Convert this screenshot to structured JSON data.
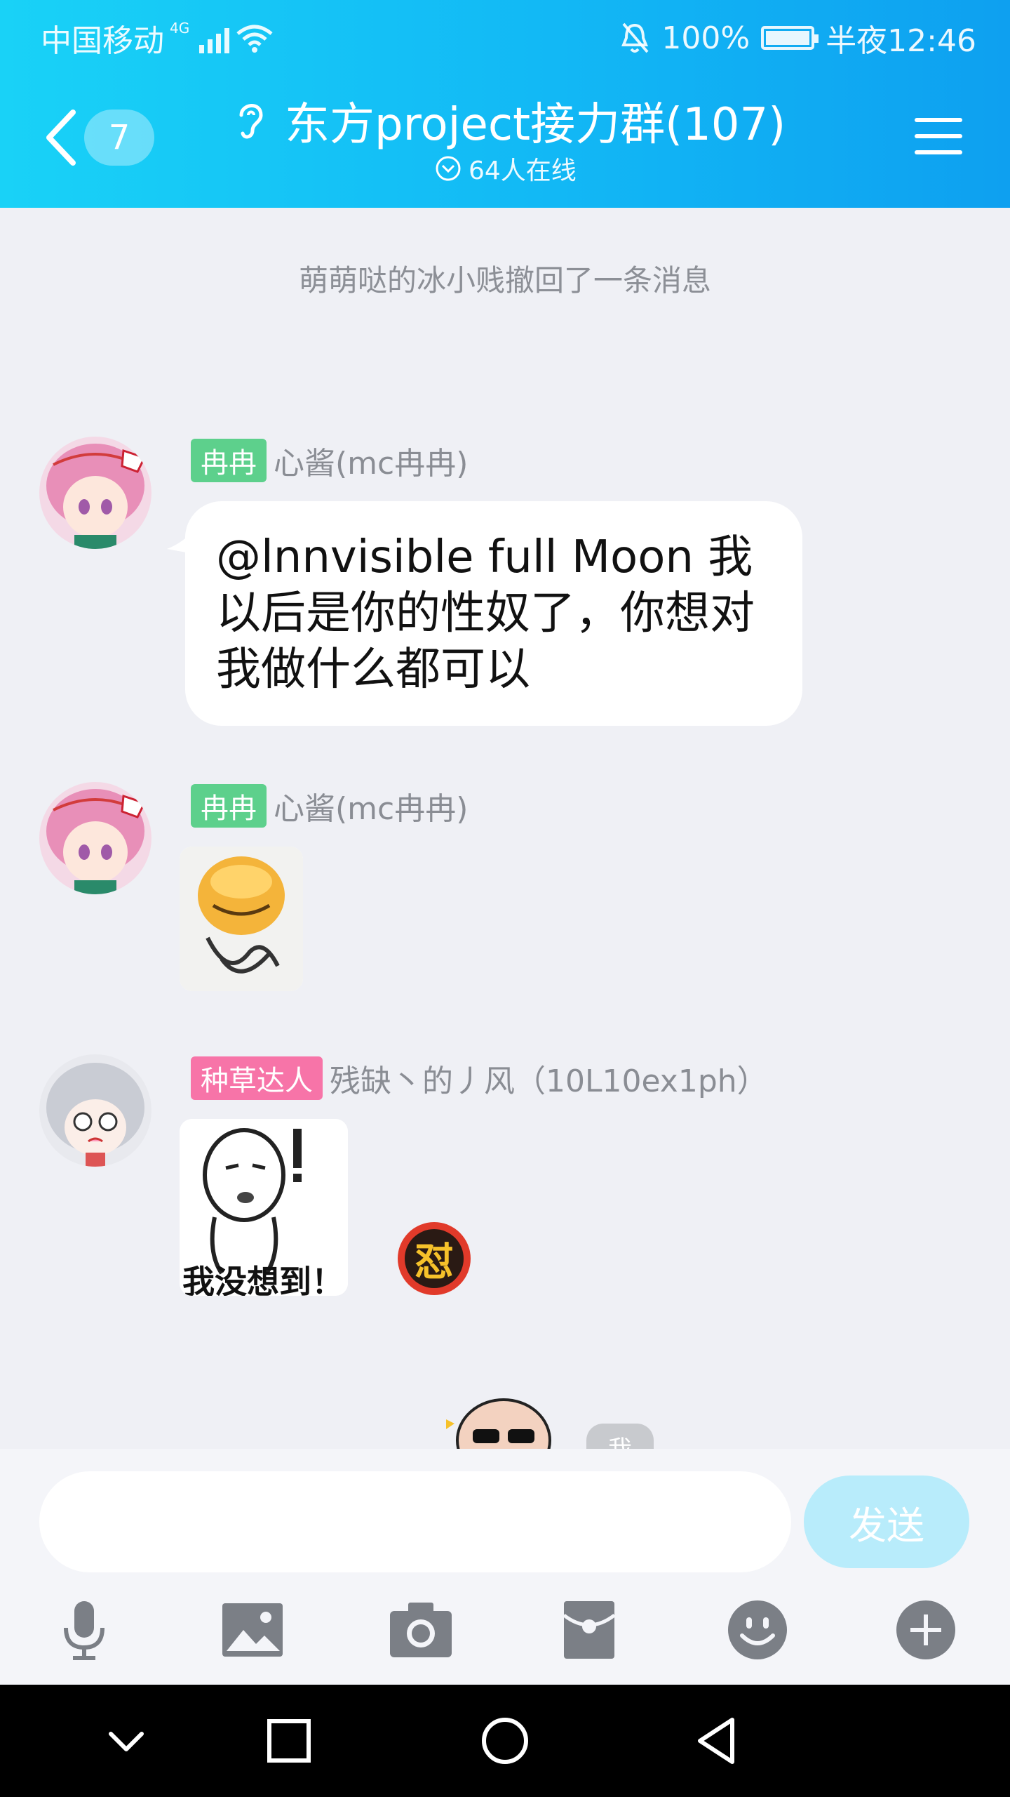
{
  "status_bar": {
    "carrier": "中国移动",
    "network": "4G",
    "battery": "100%",
    "time": "半夜12:46"
  },
  "header": {
    "unread_count": "7",
    "group_title": "东方project接力群(107)",
    "online_text": "64人在线"
  },
  "chat": {
    "system_message": "萌萌哒的冰小贱撤回了一条消息",
    "messages": [
      {
        "tag": "冉冉",
        "sender": "心酱(mc冉冉)",
        "text": "@lnnvisible full Moon 我以后是你的性奴了，你想对我做什么都可以"
      },
      {
        "tag": "冉冉",
        "sender": "心酱(mc冉冉)",
        "sticker": "smiling-face-sticker"
      },
      {
        "tag": "种草达人",
        "sender": "残缺丶的丿风（10L10ex1ph）",
        "sticker_caption": "我没想到！",
        "stamp_text": "怼"
      }
    ],
    "me_label": "我"
  },
  "composer": {
    "input_value": "",
    "send_label": "发送",
    "tools": [
      "mic-icon",
      "image-icon",
      "camera-icon",
      "red-packet-icon",
      "emoji-icon",
      "plus-icon"
    ]
  },
  "colors": {
    "header_start": "#19d2f7",
    "header_end": "#0ea0f0",
    "tag_green": "#5dd08c",
    "tag_pink": "#f774a8",
    "send_button": "#b8ecfb"
  }
}
